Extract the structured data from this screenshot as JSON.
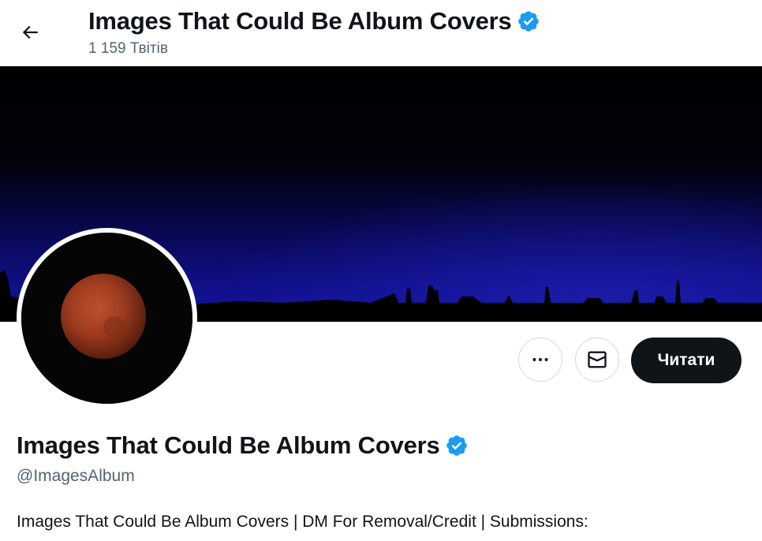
{
  "header": {
    "back_icon": "arrow-left-icon",
    "title": "Images That Could Be Album Covers",
    "tweet_count": "1 159 Твітів",
    "verified_icon": "verified-badge-icon"
  },
  "banner": {
    "description": "night sky with city skyline silhouette"
  },
  "avatar": {
    "description": "red lunar eclipse moon"
  },
  "actions": {
    "more_icon": "more-horizontal-icon",
    "message_icon": "mail-icon",
    "follow_label": "Читати"
  },
  "profile": {
    "name": "Images That Could Be Album Covers",
    "handle": "@ImagesAlbum",
    "bio": "Images That Could Be Album Covers | DM For Removal/Credit | Submissions:",
    "bio_link": ""
  },
  "colors": {
    "accent": "#1d9bf0",
    "text_primary": "#0f1419",
    "text_secondary": "#536471",
    "button_dark": "#0f1419"
  }
}
